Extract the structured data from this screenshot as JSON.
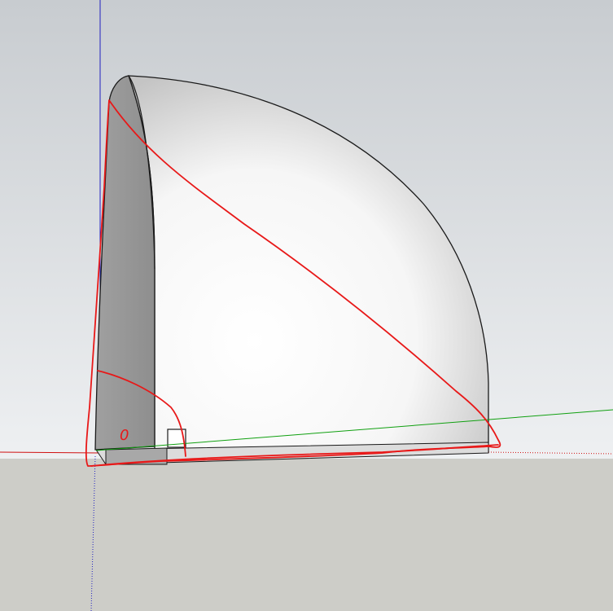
{
  "viewport": {
    "sky_top_color": "#c8ccd0",
    "sky_bottom_color": "#eef0f2",
    "ground_color": "#cdcdc8",
    "axes": {
      "red_axis_color": "#d01010",
      "green_axis_color": "#10a010",
      "blue_axis_color": "#2020c0"
    },
    "model": {
      "description_icon": "quarter-dome-solid-icon",
      "dome_light_color": "#ffffff",
      "dome_shade_color": "#c4c4c4",
      "inner_face_color": "#8e8e8e",
      "edge_color": "#1a1a1a"
    },
    "markup": {
      "stroke_color": "#e81818",
      "handwritten_label": "0"
    }
  }
}
